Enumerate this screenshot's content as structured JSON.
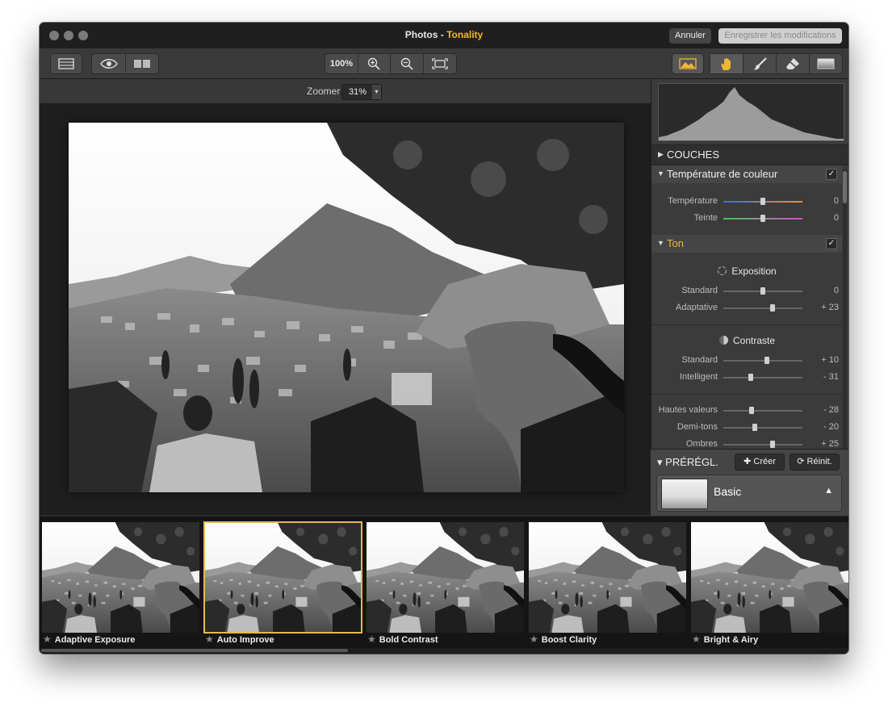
{
  "window": {
    "app": "Photos",
    "separator": " - ",
    "plugin": "Tonality"
  },
  "titlebar": {
    "cancel_label": "Annuler",
    "save_label": "Enregistrer les modifications"
  },
  "toolbar": {
    "zoom_level": "100%",
    "icons": [
      "layout-icon",
      "eye-icon",
      "split-view-icon",
      "zoom-in-icon",
      "zoom-out-icon",
      "fit-screen-icon",
      "image-tool-icon",
      "hand-icon",
      "brush-icon",
      "eraser-icon",
      "gradient-icon"
    ]
  },
  "zoombar": {
    "label": "Zoomer",
    "value": "31%",
    "arrow": "▾"
  },
  "panel": {
    "layers_title": "COUCHES",
    "temperature": {
      "title": "Température de couleur",
      "checked": "✓",
      "sliders": [
        {
          "label": "Température",
          "value": "0",
          "pos": 0.5
        },
        {
          "label": "Teinte",
          "value": "0",
          "pos": 0.5
        }
      ]
    },
    "tone": {
      "title": "Ton",
      "checked": "✓",
      "exposure_title": "Exposition",
      "exposure": [
        {
          "label": "Standard",
          "value": "0",
          "pos": 0.5
        },
        {
          "label": "Adaptative",
          "value": "+ 23",
          "pos": 0.62
        }
      ],
      "contrast_title": "Contraste",
      "contrast": [
        {
          "label": "Standard",
          "value": "+ 10",
          "pos": 0.55
        },
        {
          "label": "Intelligent",
          "value": "- 31",
          "pos": 0.35
        }
      ],
      "levels": [
        {
          "label": "Hautes valeurs",
          "value": "- 28",
          "pos": 0.36
        },
        {
          "label": "Demi-tons",
          "value": "- 20",
          "pos": 0.4
        },
        {
          "label": "Ombres",
          "value": "+ 25",
          "pos": 0.62
        }
      ]
    }
  },
  "presets": {
    "title": "PRÉRÉGL.",
    "create_label": "Créer",
    "reset_label": "Réinit.",
    "current": "Basic",
    "arrow": "▲",
    "tri": "▾"
  },
  "filmstrip": {
    "items": [
      {
        "label": "Adaptive Exposure"
      },
      {
        "label": "Auto Improve"
      },
      {
        "label": "Bold Contrast"
      },
      {
        "label": "Boost Clarity"
      },
      {
        "label": "Bright & Airy"
      }
    ],
    "star": "★"
  },
  "colors": {
    "accent": "#f2b632",
    "selection": "#e8b84a"
  }
}
